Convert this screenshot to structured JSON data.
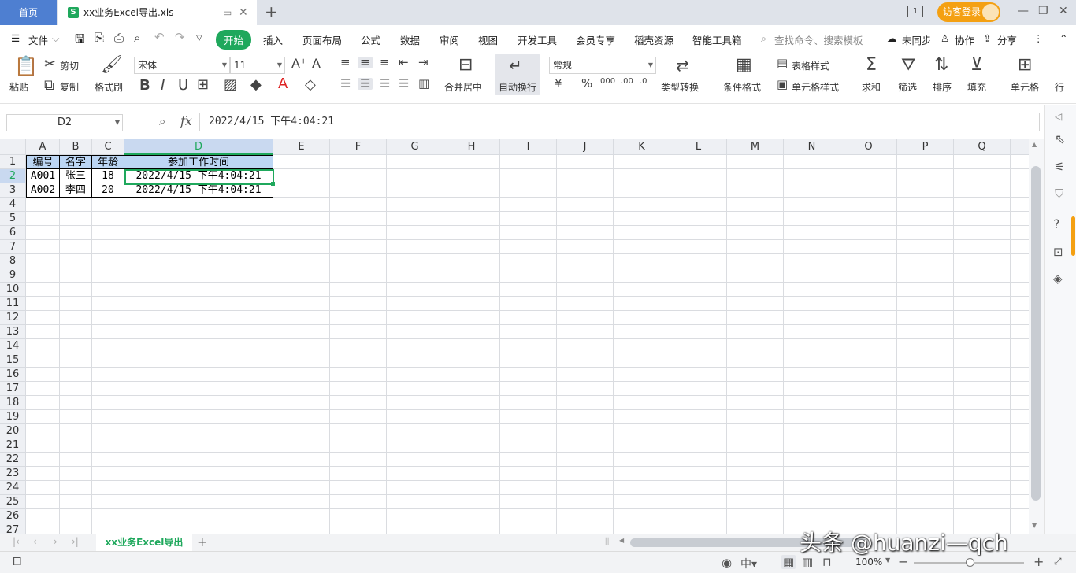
{
  "titlebar": {
    "home_tab": "首页",
    "doc_tab": "xx业务Excel导出.xls",
    "doc_icon": "S",
    "login": "访客登录"
  },
  "menu": {
    "file": "文件",
    "tabs": [
      "开始",
      "插入",
      "页面布局",
      "公式",
      "数据",
      "审阅",
      "视图",
      "开发工具",
      "会员专享",
      "稻壳资源",
      "智能工具箱"
    ],
    "search": "查找命令、搜索模板",
    "unsync": "未同步",
    "collab": "协作",
    "share": "分享"
  },
  "toolbar": {
    "paste": "粘贴",
    "cut": "剪切",
    "copy": "复制",
    "format_painter": "格式刷",
    "font_name": "宋体",
    "font_size": "11",
    "merge": "合并居中",
    "wrap": "自动换行",
    "number_format": "常规",
    "currency": "¥",
    "percent": "%",
    "convert": "类型转换",
    "cond_format": "条件格式",
    "table_style": "表格样式",
    "cell_style": "单元格样式",
    "sum": "求和",
    "filter": "筛选",
    "sort": "排序",
    "fill": "填充",
    "cell": "单元格",
    "row": "行"
  },
  "formula": {
    "name_box": "D2",
    "fx": "fx",
    "content": "2022/4/15  下午4:04:21"
  },
  "sheet": {
    "columns": [
      "A",
      "B",
      "C",
      "D",
      "E",
      "F",
      "G",
      "H",
      "I",
      "J",
      "K",
      "L",
      "M",
      "N",
      "O",
      "P",
      "Q"
    ],
    "selected_column": "D",
    "selected_row": 2,
    "row_count": 27,
    "rows": [
      [
        "编号",
        "名字",
        "年龄",
        "参加工作时间"
      ],
      [
        "A001",
        "张三",
        "18",
        "2022/4/15 下午4:04:21"
      ],
      [
        "A002",
        "李四",
        "20",
        "2022/4/15 下午4:04:21"
      ]
    ]
  },
  "sheet_tab": "xx业务Excel导出",
  "status": {
    "zoom": "100%"
  },
  "watermark": "头条 @huanzi—qch",
  "colors": {
    "accent": "#1fa85c",
    "header_fill": "#bcd6f4",
    "home_tab": "#4e7fd1",
    "login": "#f4a012"
  }
}
